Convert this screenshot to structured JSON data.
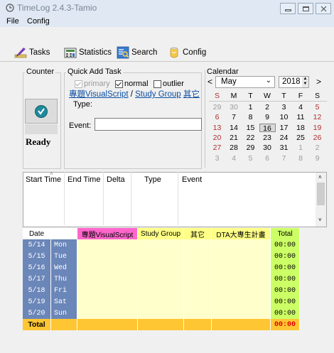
{
  "window": {
    "title": "TimeLog 2.4.3-Tamio"
  },
  "menu": [
    "File",
    "Config"
  ],
  "tabs": [
    {
      "label": "Tasks",
      "icon": "pencil-ruler-icon"
    },
    {
      "label": "Statistics",
      "icon": "calculator-icon"
    },
    {
      "label": "Search",
      "icon": "search-list-icon"
    },
    {
      "label": "Config",
      "icon": "config-jar-icon"
    }
  ],
  "counter": {
    "label": "Counter",
    "status": "Ready"
  },
  "quick_add": {
    "label": "Quick Add Task",
    "options": [
      {
        "label": "primary",
        "checked": true,
        "disabled": true
      },
      {
        "label": "normal",
        "checked": true,
        "disabled": false
      },
      {
        "label": "outlier",
        "checked": false,
        "disabled": false
      }
    ],
    "links": [
      "專題VisualScript",
      "Study Group",
      "其它"
    ],
    "link_sep": " / ",
    "type_label": "Type:",
    "event_label": "Event:",
    "event_value": ""
  },
  "calendar": {
    "label": "Calendar",
    "month": "May",
    "year": "2018",
    "weekdays": [
      "S",
      "M",
      "T",
      "W",
      "T",
      "F",
      "S"
    ],
    "weeks": [
      [
        "29",
        "30",
        "1",
        "2",
        "3",
        "4",
        "5"
      ],
      [
        "6",
        "7",
        "8",
        "9",
        "10",
        "11",
        "12"
      ],
      [
        "13",
        "14",
        "15",
        "16",
        "17",
        "18",
        "19"
      ],
      [
        "20",
        "21",
        "22",
        "23",
        "24",
        "25",
        "26"
      ],
      [
        "27",
        "28",
        "29",
        "30",
        "31",
        "1",
        "2"
      ],
      [
        "3",
        "4",
        "5",
        "6",
        "7",
        "8",
        "9"
      ]
    ],
    "selected": "16"
  },
  "log_table": {
    "columns": [
      "Start Time",
      "End Time",
      "Delta",
      "Type",
      "Event"
    ]
  },
  "stats": {
    "headers": [
      "Date",
      "",
      "專題VisualScript",
      "Study Group",
      "其它",
      "DTA大專生計畫",
      "Total"
    ],
    "rows": [
      {
        "date": "5/14",
        "day": "Mon",
        "total": "00:00"
      },
      {
        "date": "5/15",
        "day": "Tue",
        "total": "00:00"
      },
      {
        "date": "5/16",
        "day": "Wed",
        "total": "00:00"
      },
      {
        "date": "5/17",
        "day": "Thu",
        "total": "00:00"
      },
      {
        "date": "5/18",
        "day": "Fri",
        "total": "00:00"
      },
      {
        "date": "5/19",
        "day": "Sat",
        "total": "00:00"
      },
      {
        "date": "5/20",
        "day": "Sun",
        "total": "00:00"
      }
    ],
    "footer": {
      "label": "Total",
      "total": "00:00"
    },
    "colors": {
      "header_pink": "#ff66cc",
      "header_yellow": "#ffff88",
      "body_yellow": "#ffffcc",
      "total_green": "#ccff66",
      "date_blue": "#6b86b8",
      "footer_orange": "#ffc633",
      "footer_red": "#e00000"
    }
  }
}
